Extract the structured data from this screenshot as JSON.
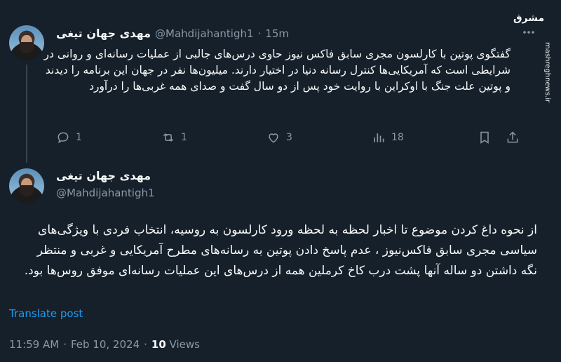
{
  "watermark": {
    "logo_text": "مشرق",
    "site": "mashreghnews.ir"
  },
  "tweet1": {
    "name": "مهدی جهان تیغی",
    "handle": "@Mahdijahantigh1",
    "sep": "·",
    "time": "15m",
    "text": "گفتگوی پوتین با کارلسون مجری سابق فاکس نیوز حاوی درس‌های جالبی از عملیات رسانه‌ای و روانی در شرایطی است که آمریکایی‌ها کنترل رسانه دنیا در اختیار دارند. میلیون‌ها نفر در جهان این برنامه را دیدند و پوتین علت جنگ با اوکراین با روایت خود پس از دو سال گفت و صدای همه غربی‌ها را درآورد",
    "actions": {
      "replies": "1",
      "reposts": "1",
      "likes": "3",
      "views": "18"
    }
  },
  "tweet2": {
    "name": "مهدی جهان تیغی",
    "handle": "@Mahdijahantigh1",
    "text": "از نحوه داغ کردن موضوع تا اخبار لحظه به لحظه ورود کارلسون به روسیه، انتخاب فردی با ویژگی‌های سیاسی مجری سابق فاکس‌نیوز ، عدم پاسخ دادن پوتین به رسانه‌های مطرح آمریکایی و غربی و منتظر نگه داشتن دو ساله آنها پشت درب کاخ کرملین همه از درس‌های این عملیات رسانه‌ای موفق روس‌ها بود.",
    "translate": "Translate post",
    "time": "11:59 AM",
    "sep1": "·",
    "date": "Feb 10, 2024",
    "sep2": "·",
    "views_count": "10",
    "views_label": "Views"
  },
  "colors": {
    "background": "#15202b",
    "accent": "#1d9bf0",
    "muted": "#8b98a5",
    "text": "#f7f9f9"
  }
}
